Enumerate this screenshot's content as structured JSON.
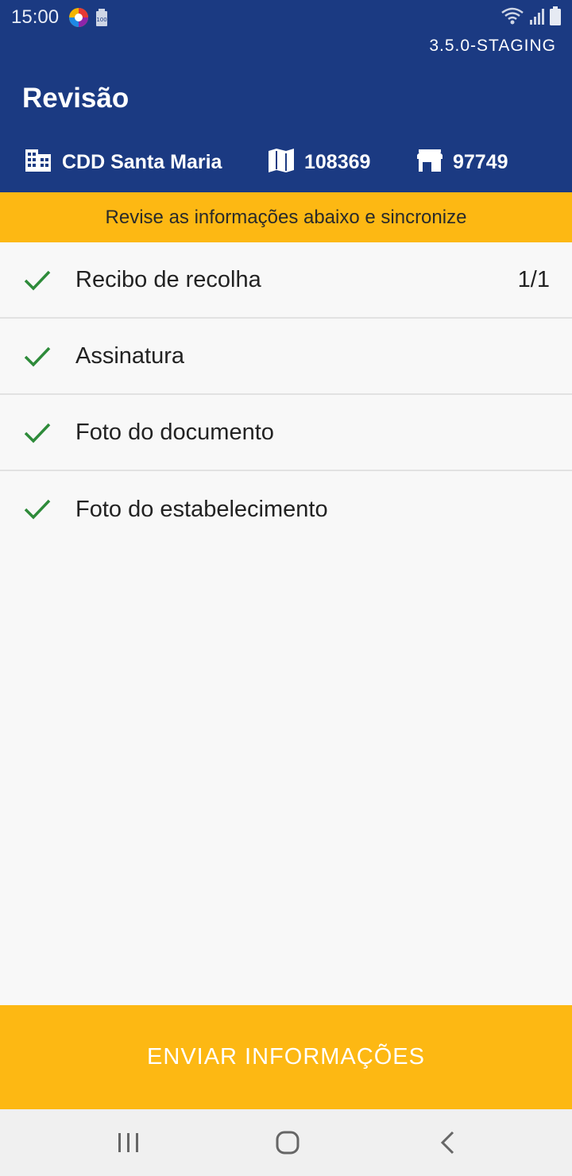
{
  "status_bar": {
    "time": "15:00",
    "icons": [
      "app-icon",
      "battery-saver-icon",
      "wifi-icon",
      "signal-icon",
      "battery-icon"
    ]
  },
  "header": {
    "version": "3.5.0-STAGING",
    "title": "Revisão",
    "info": {
      "location_label": "CDD Santa Maria",
      "map_value": "108369",
      "store_value": "97749"
    },
    "color": "#1b3a82"
  },
  "notice": {
    "text": "Revise as informações abaixo e sincronize",
    "color": "#fdb813"
  },
  "review_items": [
    {
      "label": "Recibo de recolha",
      "count": "1/1",
      "status": "check"
    },
    {
      "label": "Assinatura",
      "count": "",
      "status": "check"
    },
    {
      "label": "Foto do documento",
      "count": "",
      "status": "check"
    },
    {
      "label": "Foto do estabelecimento",
      "count": "",
      "status": "check"
    }
  ],
  "send_button": {
    "label": "ENVIAR INFORMAÇÕES",
    "color": "#fdb813"
  },
  "nav": {
    "icons": [
      "recents-icon",
      "home-icon",
      "back-icon"
    ]
  },
  "accent_check_color": "#2e8b3a"
}
